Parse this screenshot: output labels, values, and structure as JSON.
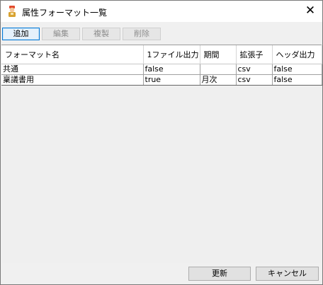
{
  "window": {
    "title": "属性フォーマット一覧",
    "close_glyph": "✕"
  },
  "toolbar": {
    "add": "追加",
    "edit": "編集",
    "duplicate": "複製",
    "delete": "削除"
  },
  "table": {
    "columns": [
      "フォーマット名",
      "1ファイル出力",
      "期間",
      "拡張子",
      "ヘッダ出力"
    ],
    "rows": [
      [
        "共通",
        "false",
        "",
        "csv",
        "false"
      ],
      [
        "稟議書用",
        "true",
        "月次",
        "csv",
        "false"
      ]
    ]
  },
  "footer": {
    "refresh": "更新",
    "cancel": "キャンセル"
  },
  "colors": {
    "accent": "#0078d7",
    "window_bg": "#f0f0f0"
  },
  "icons": {
    "app": "app-icon",
    "close": "close-icon"
  }
}
